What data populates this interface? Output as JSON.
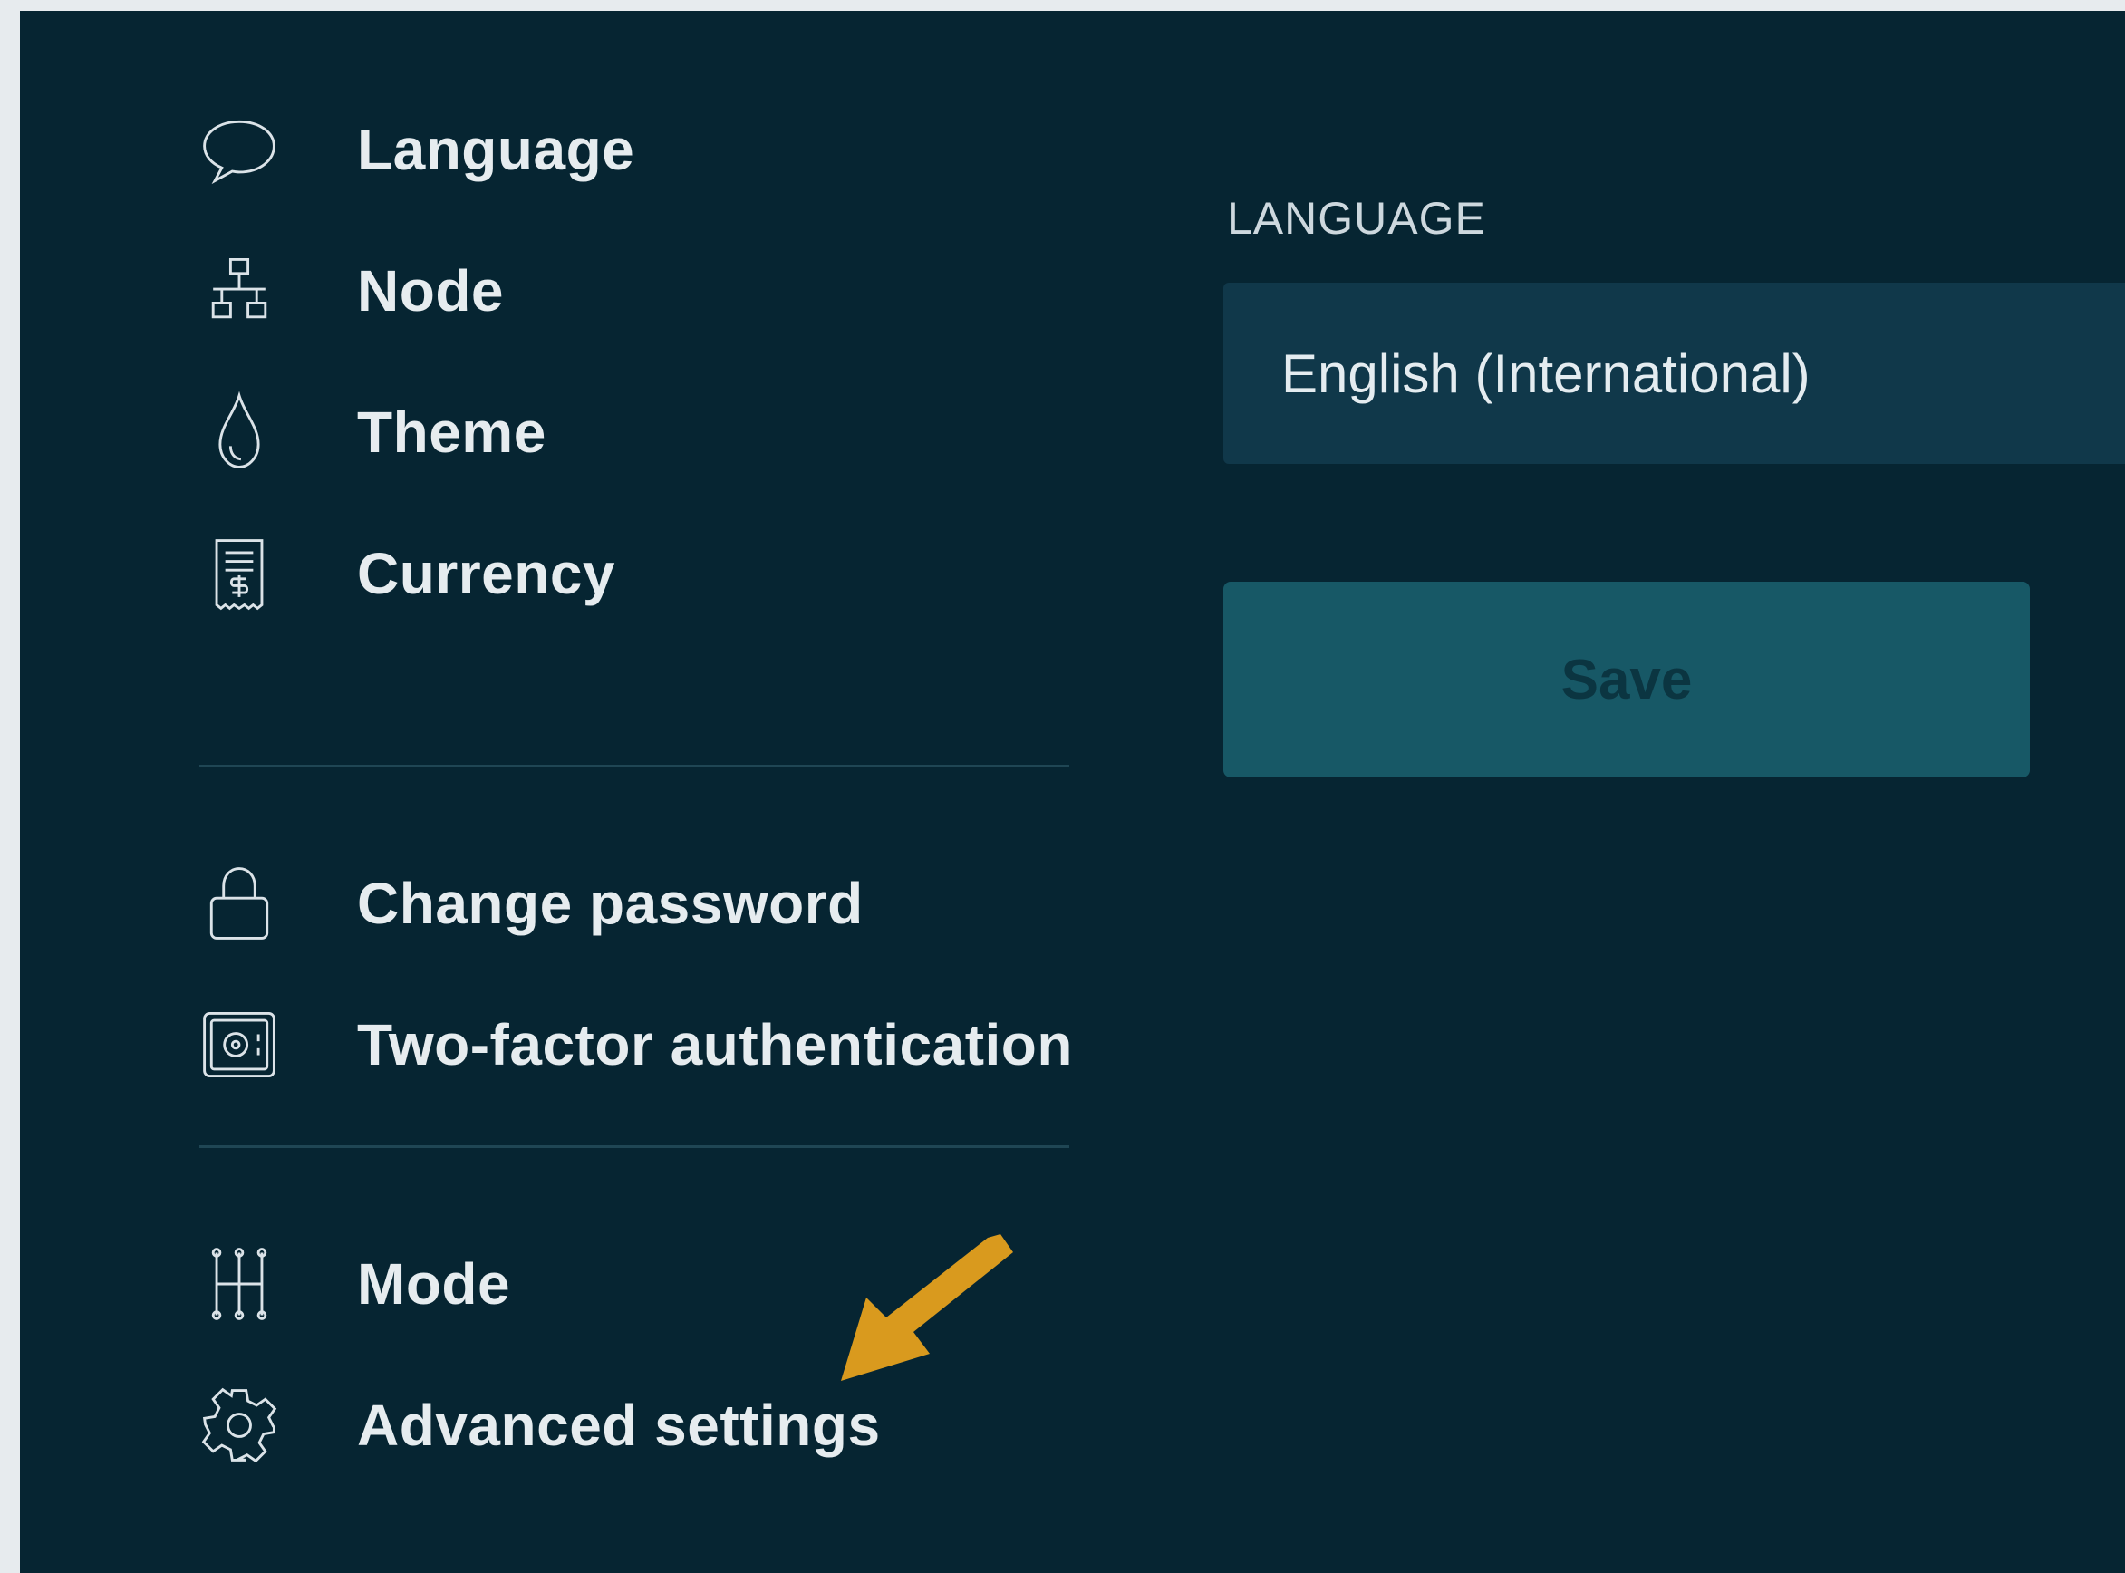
{
  "sidebar": {
    "items": [
      {
        "label": "Language",
        "icon": "speech-bubble-icon"
      },
      {
        "label": "Node",
        "icon": "network-icon"
      },
      {
        "label": "Theme",
        "icon": "droplet-icon"
      },
      {
        "label": "Currency",
        "icon": "receipt-icon"
      },
      {
        "label": "Change password",
        "icon": "lock-icon"
      },
      {
        "label": "Two-factor authentication",
        "icon": "safe-icon"
      },
      {
        "label": "Mode",
        "icon": "gear-shift-icon"
      },
      {
        "label": "Advanced settings",
        "icon": "gear-icon"
      }
    ]
  },
  "main": {
    "section_label": "LANGUAGE",
    "language_select": {
      "value": "English (International)"
    },
    "save_label": "Save"
  },
  "annotation": {
    "arrow_color": "#d99a1e"
  },
  "colors": {
    "background": "#062532",
    "select_bg": "#10384a",
    "button_bg": "#175866",
    "button_text": "#0b3541"
  }
}
